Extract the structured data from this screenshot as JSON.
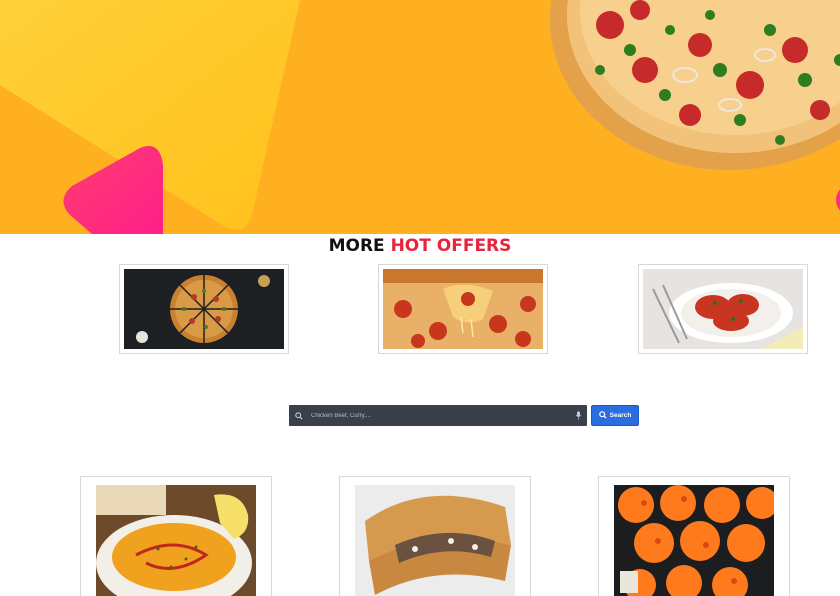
{
  "hero": {
    "background_color": "#ffb020",
    "decor_shapes": [
      "yellow-triangle",
      "pink-triangle",
      "pizza"
    ]
  },
  "offers": {
    "title_part1": "MORE",
    "title_part2": "HOT OFFERS",
    "title_color_1": "#111111",
    "title_color_2": "#e8243d",
    "items": [
      {
        "image": "sliced-pizza"
      },
      {
        "image": "cheesy-pizza-slice"
      },
      {
        "image": "chicken-dish"
      }
    ]
  },
  "search": {
    "placeholder": "Chicken Beef, Curry,...",
    "button_label": "Search",
    "icons": [
      "search-icon",
      "mic-icon"
    ]
  },
  "menu": {
    "items": [
      {
        "image": "soup-bowl"
      },
      {
        "image": "meat-pastry"
      },
      {
        "image": "sushi-rolls"
      }
    ]
  }
}
